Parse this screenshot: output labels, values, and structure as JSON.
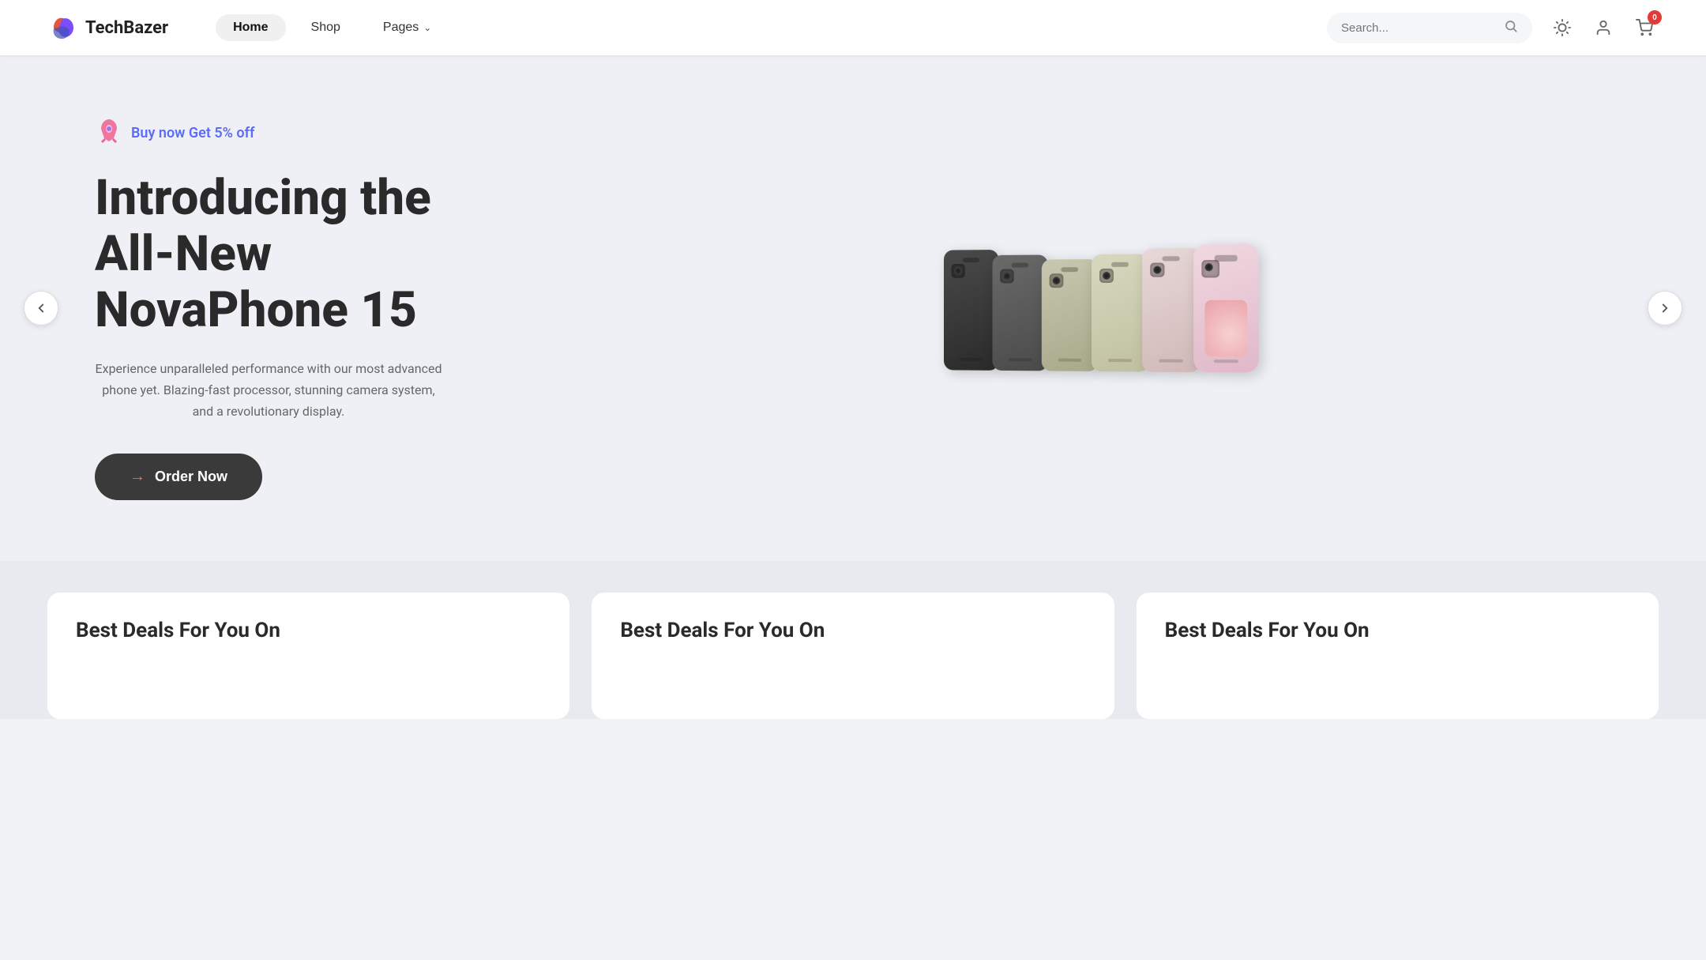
{
  "brand": {
    "name": "TechBazer"
  },
  "nav": {
    "links": [
      {
        "label": "Home",
        "active": true
      },
      {
        "label": "Shop",
        "active": false
      },
      {
        "label": "Pages",
        "active": false,
        "hasDropdown": true
      }
    ],
    "search_placeholder": "Search...",
    "cart_count": "0"
  },
  "hero": {
    "promo_text": "Buy now Get 5% off",
    "title_line1": "Introducing the",
    "title_line2": "All-New",
    "title_line3": "NovaPhone 15",
    "description": "Experience unparalleled performance with our most advanced phone yet. Blazing-fast processor, stunning camera system, and a revolutionary display.",
    "cta_label": "Order Now"
  },
  "deals": {
    "section_title": "Best Deals For You On",
    "cards": [
      {
        "title": "Best Deals For You On"
      },
      {
        "title": "Best Deals For You On"
      },
      {
        "title": "Best Deals For You On"
      }
    ]
  },
  "icons": {
    "sun": "☀",
    "user": "👤",
    "cart": "🛒",
    "search": "🔍",
    "arrow_left": "←",
    "arrow_right": "→",
    "arrow_right_btn": "→",
    "chevron_down": "⌄",
    "rocket": "🚀"
  }
}
